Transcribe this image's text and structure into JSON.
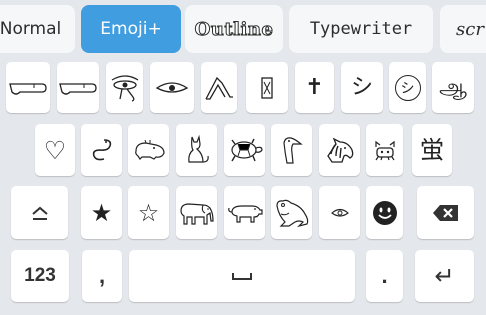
{
  "font_styles": [
    {
      "label": "Normal",
      "active": false
    },
    {
      "label": "Emoji+",
      "active": true
    },
    {
      "label": "Outline",
      "active": false
    },
    {
      "label": "Typewriter",
      "active": false
    },
    {
      "label": "scr",
      "active": false
    }
  ],
  "colors": {
    "accent": "#3f9de0",
    "background": "#e4e7eb",
    "key": "#ffffff"
  },
  "rows": {
    "row1": [
      "hieroglyph-arm-icon",
      "hieroglyph-arm-icon",
      "eye-of-horus-icon",
      "eye-icon",
      "legs-icon",
      "hieroglyph-box-icon",
      "✝",
      "シ",
      "シ-circle",
      "ஆ"
    ],
    "row2": [
      "♡",
      "snake-icon",
      "hippo-icon",
      "cat-icon",
      "turtle-icon",
      "bird-head-icon",
      "horse-head-icon",
      "crab-icon",
      "蛍"
    ],
    "row3": [
      "shift-icon",
      "★",
      "☆",
      "elephant-icon",
      "pig-icon",
      "frog-icon",
      "eye-small-icon",
      "smiley-dark-icon",
      "backspace-icon"
    ],
    "row4": [
      "123",
      ",",
      "space-icon",
      ".",
      "enter-icon"
    ]
  },
  "keys": {
    "cross": "✝",
    "shi": "シ",
    "shi_circle": "シ",
    "tamil": "ஆ",
    "heart": "♡",
    "kanji": "蛍",
    "star_filled": "★",
    "star_outline": "☆",
    "numbers": "123",
    "comma": ",",
    "period": ".",
    "enter": "↵"
  }
}
